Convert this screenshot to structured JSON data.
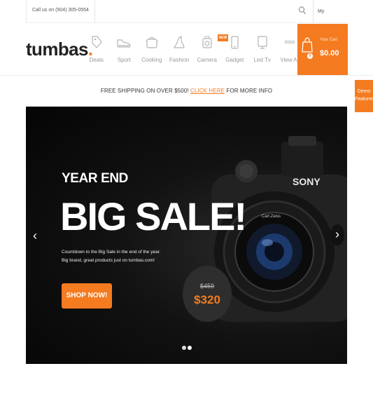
{
  "topbar": {
    "phone": "Call us on (504) 305-0554",
    "account_label": "My Account",
    "account_chevron": "˅"
  },
  "brand": {
    "logo_text": "tumbas",
    "logo_dot": "."
  },
  "categories": [
    {
      "label": "Deals",
      "icon": "tag-icon"
    },
    {
      "label": "Sport",
      "icon": "shoe-icon"
    },
    {
      "label": "Cooking",
      "icon": "pot-icon"
    },
    {
      "label": "Fashion",
      "icon": "heel-icon"
    },
    {
      "label": "Camera",
      "icon": "camera-icon"
    },
    {
      "label": "Gadget",
      "icon": "phone-icon",
      "badge": "NEW"
    },
    {
      "label": "Led Tv",
      "icon": "tv-icon"
    },
    {
      "label": "View All",
      "icon": "more-icon"
    }
  ],
  "cart": {
    "label": "Your Cart",
    "total": "$0.00",
    "count": "0"
  },
  "demo_tab": {
    "line1": "Demo",
    "line2": "Features"
  },
  "notice": {
    "before": "FREE SHIPPING ON OVER $500!",
    "link": "CLICK HERE",
    "after": "FOR MORE INFO"
  },
  "hero": {
    "eyebrow": "YEAR END",
    "headline": "BIG SALE!",
    "desc_line1": "Countdown to the Big Sale in the end of the year.",
    "desc_line2": "Big brand, great products just on tumbas.com!",
    "cta": "SHOP NOW!",
    "old_price": "$459",
    "new_price": "$320",
    "prev": "‹",
    "next": "›",
    "slide_count": 2,
    "active_slide": 2,
    "camera_brand": "SONY",
    "lens_text": "Carl Zeiss"
  },
  "colors": {
    "accent": "#f47b20",
    "hero_bg": "#0b0b0b",
    "text": "#333333"
  }
}
